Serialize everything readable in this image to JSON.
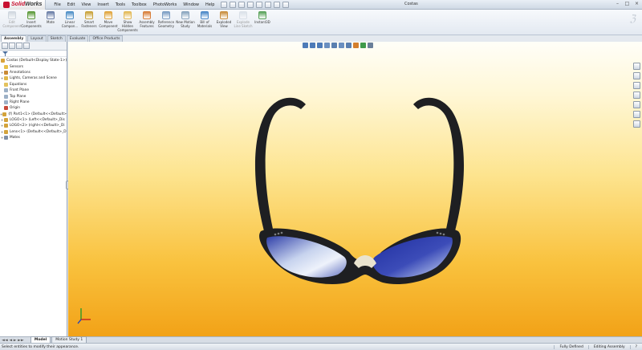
{
  "app": {
    "logo_brand": "Solid",
    "logo_brand_bold": "Works",
    "window_title": "Costas",
    "menu": [
      "File",
      "Edit",
      "View",
      "Insert",
      "Tools",
      "Toolbox",
      "PhotoWorks",
      "Window",
      "Help"
    ]
  },
  "ribbon": {
    "buttons": [
      {
        "label": "Edit Component",
        "icon": "edit-component-icon",
        "color": "#9aa8b8",
        "disabled": true
      },
      {
        "label": "Insert Components",
        "icon": "insert-components-icon",
        "color": "#5b9a3a",
        "disabled": false
      },
      {
        "label": "Mate",
        "icon": "mate-icon",
        "color": "#6b7fa8",
        "disabled": false
      },
      {
        "label": "Linear Compon...",
        "icon": "linear-pattern-icon",
        "color": "#4f8fc7",
        "disabled": false
      },
      {
        "label": "Smart Fasteners",
        "icon": "smart-fasteners-icon",
        "color": "#c9a23a",
        "disabled": false
      },
      {
        "label": "Move Component",
        "icon": "move-component-icon",
        "color": "#e0a53c",
        "disabled": false
      },
      {
        "label": "Show Hidden Components",
        "icon": "show-hidden-icon",
        "color": "#e3b957",
        "disabled": false
      },
      {
        "label": "Assembly Features",
        "icon": "assembly-features-icon",
        "color": "#d87f3b",
        "disabled": false
      },
      {
        "label": "Reference Geometry",
        "icon": "reference-geometry-icon",
        "color": "#7c9ec4",
        "disabled": false
      },
      {
        "label": "New Motion Study",
        "icon": "motion-study-icon",
        "color": "#8aa6bf",
        "disabled": false
      },
      {
        "label": "Bill of Materials",
        "icon": "bill-of-materials-icon",
        "color": "#4b88c8",
        "disabled": false
      },
      {
        "label": "Exploded View",
        "icon": "exploded-view-icon",
        "color": "#c98e3e",
        "disabled": false
      },
      {
        "label": "Explode Line Sketch",
        "icon": "explode-line-icon",
        "color": "#b7c2cf",
        "disabled": true
      },
      {
        "label": "Instant3D",
        "icon": "instant3d-icon",
        "color": "#5aa35b",
        "disabled": false
      }
    ]
  },
  "command_tabs": [
    "Assembly",
    "Layout",
    "Sketch",
    "Evaluate",
    "Office Products"
  ],
  "tree": {
    "items": [
      {
        "label": "Costas (Default<Display State-1>)",
        "icon": "assembly-icon",
        "color": "#d9a43c",
        "expander": ""
      },
      {
        "label": "Sensors",
        "icon": "sensors-icon",
        "color": "#e7c04a",
        "expander": ""
      },
      {
        "label": "Annotations",
        "icon": "annotations-icon",
        "color": "#c98a34",
        "expander": "+"
      },
      {
        "label": "Lights, Cameras and Scene",
        "icon": "lights-icon",
        "color": "#e0b84a",
        "expander": "+"
      },
      {
        "label": "Equations",
        "icon": "equations-icon",
        "color": "#e3c25e",
        "expander": ""
      },
      {
        "label": "Front Plane",
        "icon": "plane-icon",
        "color": "#9cb0c6",
        "expander": ""
      },
      {
        "label": "Top Plane",
        "icon": "plane-icon",
        "color": "#9cb0c6",
        "expander": ""
      },
      {
        "label": "Right Plane",
        "icon": "plane-icon",
        "color": "#9cb0c6",
        "expander": ""
      },
      {
        "label": "Origin",
        "icon": "origin-icon",
        "color": "#c84a3a",
        "expander": ""
      },
      {
        "label": "(f) Part1<1> (Default<<Default>",
        "icon": "part-icon",
        "color": "#d3a33c",
        "expander": "+"
      },
      {
        "label": "LOGO<1> (Left<<Default>_Dis",
        "icon": "part-icon",
        "color": "#d3a33c",
        "expander": "+"
      },
      {
        "label": "LOGO<2> (right<<Default>_Di",
        "icon": "part-icon",
        "color": "#d3a33c",
        "expander": "+"
      },
      {
        "label": "Lens<1> (Default<<Default>_D",
        "icon": "part-icon",
        "color": "#d3a33c",
        "expander": "+"
      },
      {
        "label": "Mates",
        "icon": "mates-icon",
        "color": "#7f8fa6",
        "expander": "+"
      }
    ]
  },
  "bottom_tabs": [
    "Model",
    "Motion Study 1"
  ],
  "status": {
    "message": "Select entities to modify their appearance.",
    "state": "Fully Defined",
    "mode": "Editing Assembly"
  },
  "colors": {
    "frame": "#1e1f22",
    "lens_blue": "#2f3fa8",
    "lens_light": "#c7d3ee",
    "background_top": "#fffef8",
    "background_bottom": "#f2a217"
  }
}
